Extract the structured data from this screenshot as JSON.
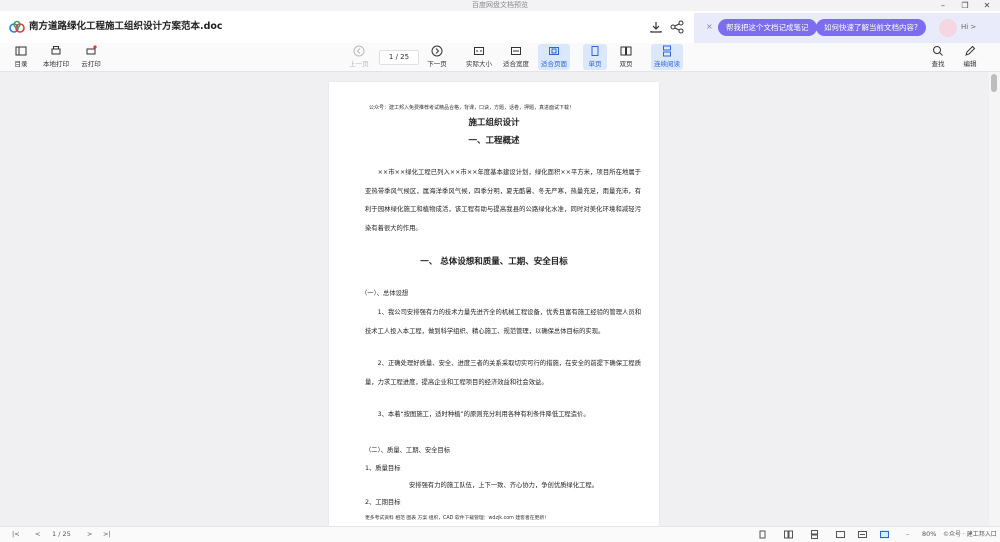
{
  "os": {
    "title": "百度网盘文档预览",
    "min": "–",
    "restore": "❐",
    "close": "✕"
  },
  "header": {
    "doc_title": "南方道路绿化工程施工组织设计方案范本.doc"
  },
  "ai": {
    "close": "×",
    "chip1": "帮我把这个文档记成笔记",
    "chip2": "如何快速了解当前文档内容?",
    "hi": "Hi >"
  },
  "toolbar": {
    "catalog": "目录",
    "local_print": "本地打印",
    "cloud_print": "云打印",
    "prev": "上一页",
    "page_display": "1 / 25",
    "next": "下一页",
    "actual_size": "实际大小",
    "fit_width": "适合宽度",
    "fit_page": "适合页面",
    "single": "单页",
    "double": "双页",
    "continuous": "连续阅读",
    "search": "查找",
    "edit": "编辑"
  },
  "document": {
    "ad_top": "公众号：建工邦入免费推荐考试精品合格，背课，口诀，方题，话卷，押题，真进面试下载！",
    "title": "施工组织设计",
    "section1": "一、工程概述",
    "para1": "××市××绿化工程已列入××市××年度基本建设计划，绿化面积××平方米，项目所在地属于亚热带季风气候区，属海洋季风气候，四季分明，夏无酷暑、冬无严寒，热量充足，雨量充沛，有利于园林绿化施工和植物成活，该工程有助与提高我县的公路绿化水准，同时对美化环境和减轻污染有着很大的作用。",
    "section2": "一、 总体设想和质量、工期、安全目标",
    "sub1": "（一）、总体设想",
    "item1": "1、我公司安排强有力的技术力量先进齐全的机械工程设备，优秀且富有施工经验的管理人员和技术工人投入本工程，做到科学组织、精心施工、规范管理，以确保总体目标的实现。",
    "item2": "2、正确处理好质量、安全、进度三者的关系采取切实可行的措施，在安全的前提下确保工程质量，力求工程进度，提高企业和工程项目的经济效益和社会效益。",
    "item3": "3、本着“按图施工，适时种植”的原则充分利用各种有利条件降低工程造价。",
    "sub2": "（二）、质量、工期、安全目标",
    "q1": "1、质量目标",
    "q1_text": "安排强有力的施工队伍，上下一致、齐心协力，争创优质绿化工程。",
    "q2": "2、工期目标",
    "ad_bottom": "更多考试资料 相范 图表 方案 组织，CAD 软件下载管理：wdzjk.com 建客者在更新！"
  },
  "status": {
    "page": "1 / 25",
    "zoom": "80%",
    "watermark": "©众号 · 建工邦入口"
  }
}
